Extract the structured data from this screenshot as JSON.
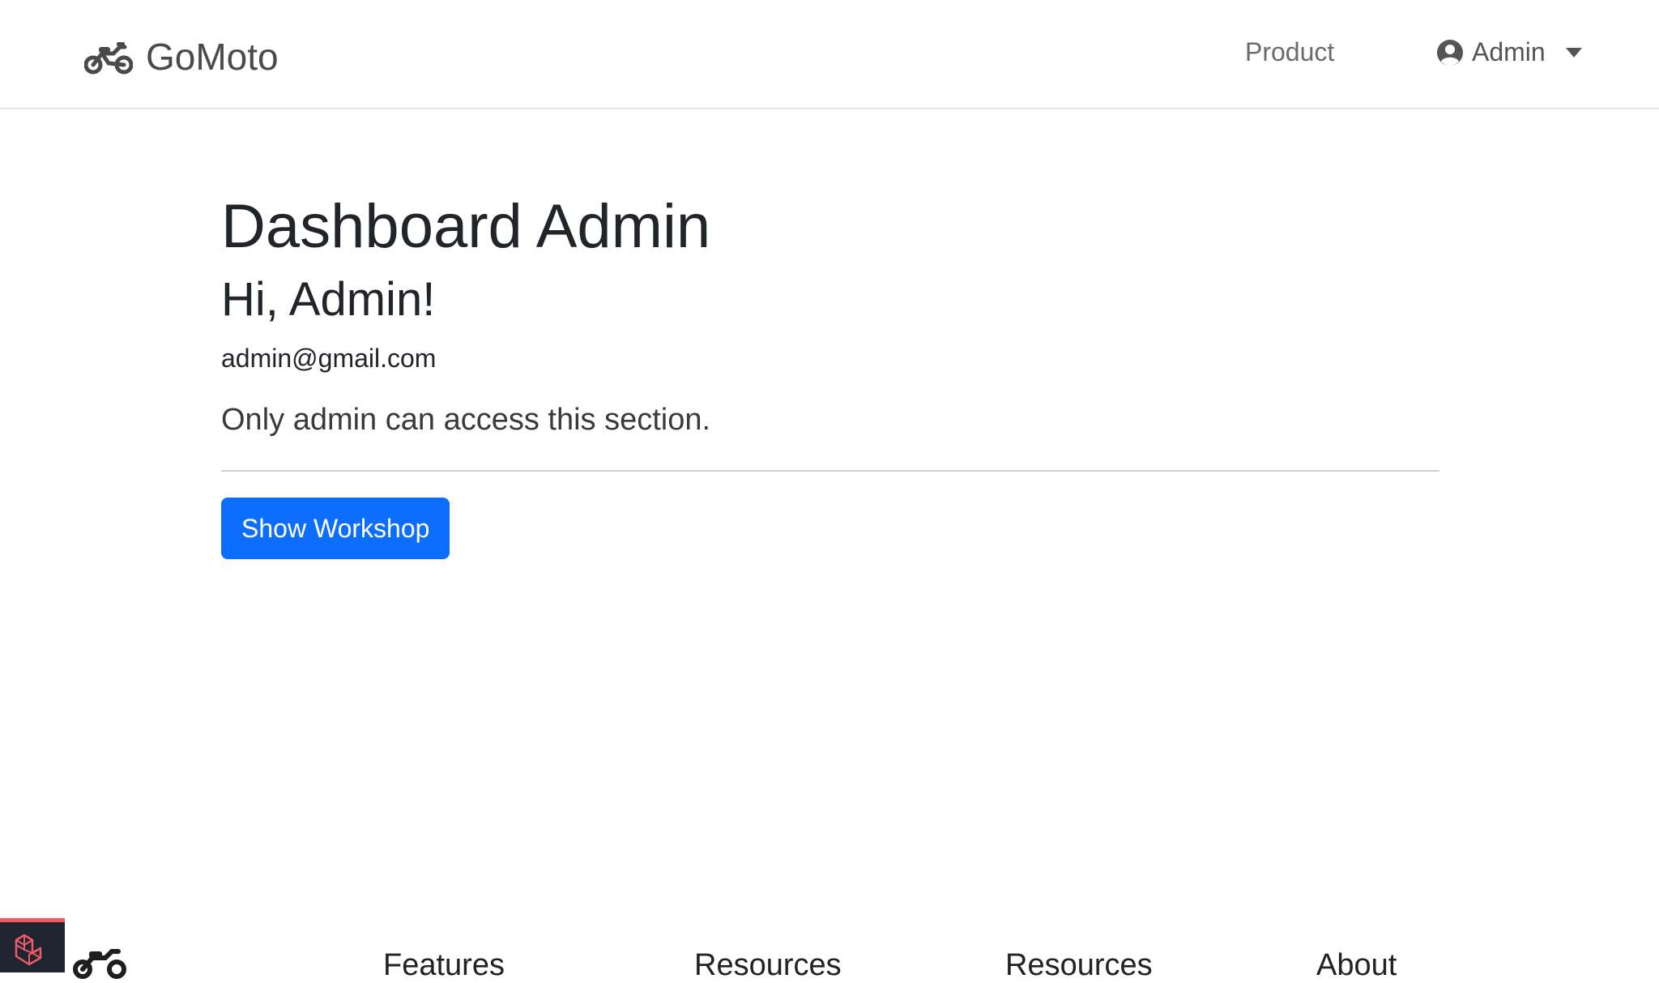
{
  "navbar": {
    "brand": "GoMoto",
    "links": {
      "product": "Product"
    },
    "user_menu": "Admin"
  },
  "main": {
    "title": "Dashboard Admin",
    "greeting": "Hi, Admin!",
    "email": "admin@gmail.com",
    "lead": "Only admin can access this section.",
    "button_label": "Show Workshop"
  },
  "footer": {
    "columns": [
      "Features",
      "Resources",
      "Resources",
      "About"
    ]
  },
  "colors": {
    "primary": "#0d6efd",
    "text": "#212529",
    "nav_text": "#6b6b6b",
    "debugbar_bg": "#1f2530",
    "debugbar_accent": "#f05a66"
  },
  "icons": {
    "brand": "motorcycle-icon",
    "user": "user-circle-icon",
    "caret": "caret-down-icon",
    "debugbar": "laravel-icon"
  }
}
